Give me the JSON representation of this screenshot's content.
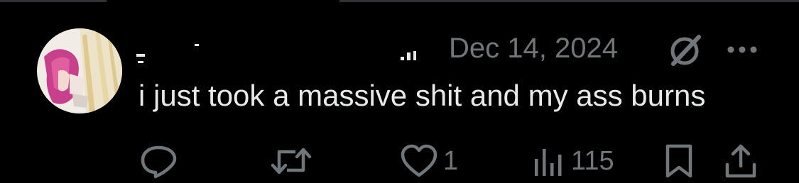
{
  "tweet": {
    "timestamp": "Dec 14, 2024",
    "text": "i just took a massive shit and my ass burns"
  },
  "actions": {
    "reply_count": "",
    "retweet_count": "",
    "like_count": "1",
    "view_count": "115"
  },
  "icons": {
    "reply": "reply-icon",
    "retweet": "retweet-icon",
    "like": "heart-icon",
    "views": "views-icon",
    "bookmark": "bookmark-icon",
    "share": "share-icon",
    "grok": "grok-icon",
    "more": "more-icon"
  },
  "colors": {
    "background": "#000000",
    "text_primary": "#e7e9ea",
    "text_secondary": "#71767b"
  }
}
